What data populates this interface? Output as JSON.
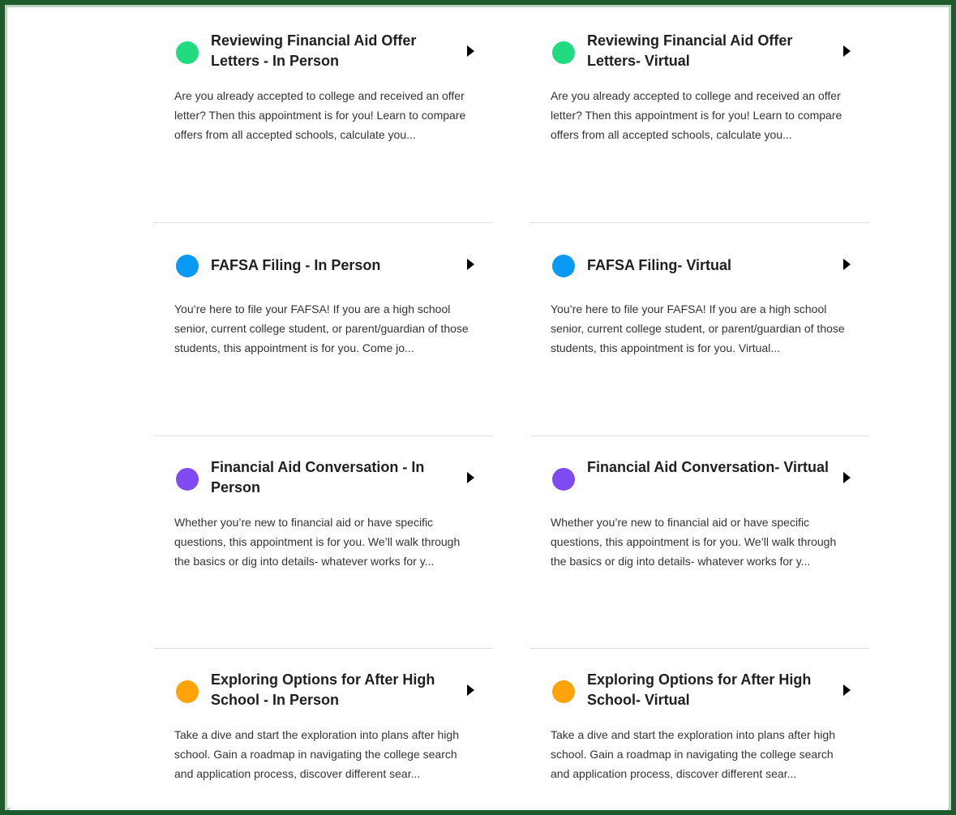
{
  "colors": {
    "green": "#20db7f",
    "blue": "#0a9af5",
    "purple": "#7f4af2",
    "orange": "#ffa30a",
    "frame": "#1d5a2c"
  },
  "icons": {
    "dot": "circle-status-icon",
    "arrow": "chevron-right-icon"
  },
  "appointments": [
    {
      "title": "Reviewing Financial Aid Offer Letters - In Person",
      "description": "Are you already accepted to college and received an offer letter? Then this appointment is for you! Learn to compare offers from all accepted schools, calculate you..."
    },
    {
      "title": "Reviewing Financial Aid Offer Letters- Virtual",
      "description": "Are you already accepted to college and received an offer letter? Then this appointment is for you! Learn to compare offers from all accepted schools, calculate you..."
    },
    {
      "title": "FAFSA Filing - In Person",
      "description": "You’re here to file your FAFSA! If you are a high school senior, current college student, or parent/guardian of those students, this appointment is for you. Come jo..."
    },
    {
      "title": "FAFSA Filing- Virtual",
      "description": "You’re here to file your FAFSA! If you are a high school senior, current college student, or parent/guardian of those students, this appointment is for you. Virtual..."
    },
    {
      "title": "Financial Aid Conversation - In Person",
      "description": "Whether you’re new to financial aid or have specific questions, this appointment is for you. We’ll walk through the basics or dig into details- whatever works for y..."
    },
    {
      "title": "Financial Aid Conversation- Virtual",
      "description": "Whether you’re new to financial aid or have specific questions, this appointment is for you. We’ll walk through the basics or dig into details- whatever works for y..."
    },
    {
      "title": "Exploring Options for After High School - In Person",
      "description": "Take a dive and start the exploration into plans after high school. Gain a roadmap in navigating the college search and application process, discover different sear..."
    },
    {
      "title": "Exploring Options for After High School- Virtual",
      "description": "Take a dive and start the exploration into plans after high school. Gain a roadmap in navigating the college search and application process, discover different sear..."
    }
  ]
}
